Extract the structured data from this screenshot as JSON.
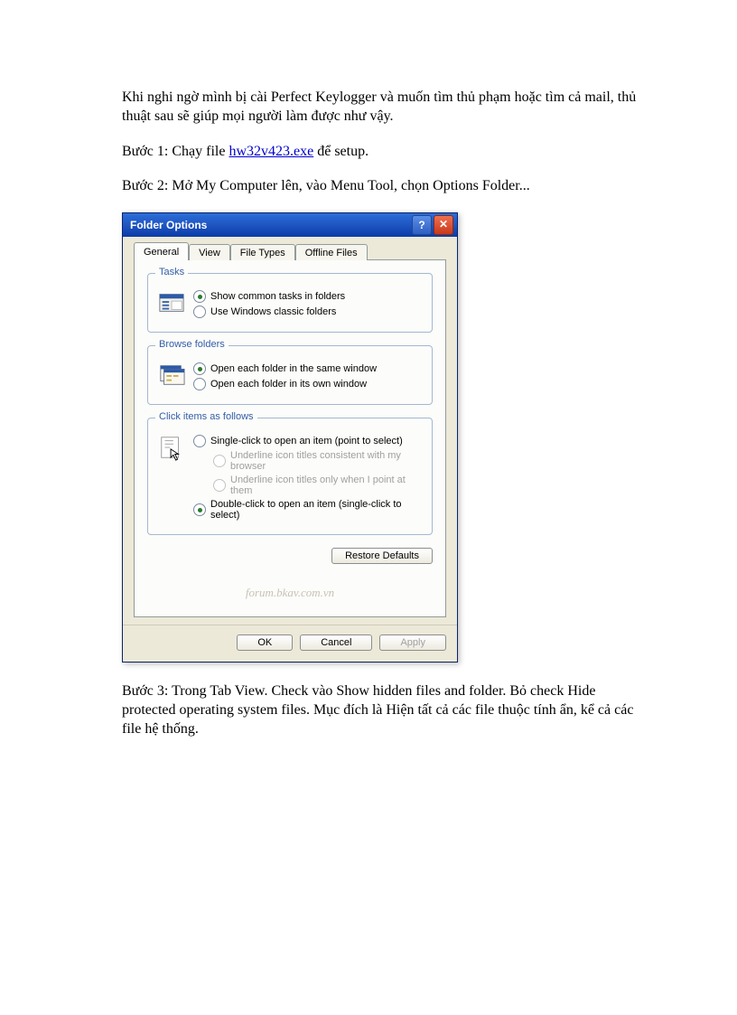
{
  "doc": {
    "intro": "Khi nghi ngờ mình bị cài Perfect Keylogger và muốn tìm thủ phạm hoặc tìm cả mail, thủ thuật sau sẽ giúp mọi người làm được như vậy.",
    "step1_prefix": "Bước 1: Chạy file ",
    "step1_link": "hw32v423.exe",
    "step1_suffix": " để setup.",
    "step2": "Bước 2: Mở My Computer lên, vào Menu Tool, chọn Options Folder...",
    "step3": "Bước 3: Trong Tab View. Check vào Show hidden files and folder. Bỏ check Hide protected operating system files. Mục đích là Hiện tất cả các file thuộc tính ẩn, kể cả các file hệ thống."
  },
  "dialog": {
    "title": "Folder Options",
    "help_glyph": "?",
    "close_glyph": "✕",
    "tabs": {
      "general": "General",
      "view": "View",
      "filetypes": "File Types",
      "offline": "Offline Files"
    },
    "tasks": {
      "legend": "Tasks",
      "show_common": "Show common tasks in folders",
      "classic": "Use Windows classic folders"
    },
    "browse": {
      "legend": "Browse folders",
      "same_window": "Open each folder in the same window",
      "own_window": "Open each folder in its own window"
    },
    "click": {
      "legend": "Click items as follows",
      "single": "Single-click to open an item (point to select)",
      "underline_browser": "Underline icon titles consistent with my browser",
      "underline_point": "Underline icon titles only when I point at them",
      "double": "Double-click to open an item (single-click to select)"
    },
    "restore": "Restore Defaults",
    "watermark": "forum.bkav.com.vn",
    "ok": "OK",
    "cancel": "Cancel",
    "apply": "Apply"
  }
}
